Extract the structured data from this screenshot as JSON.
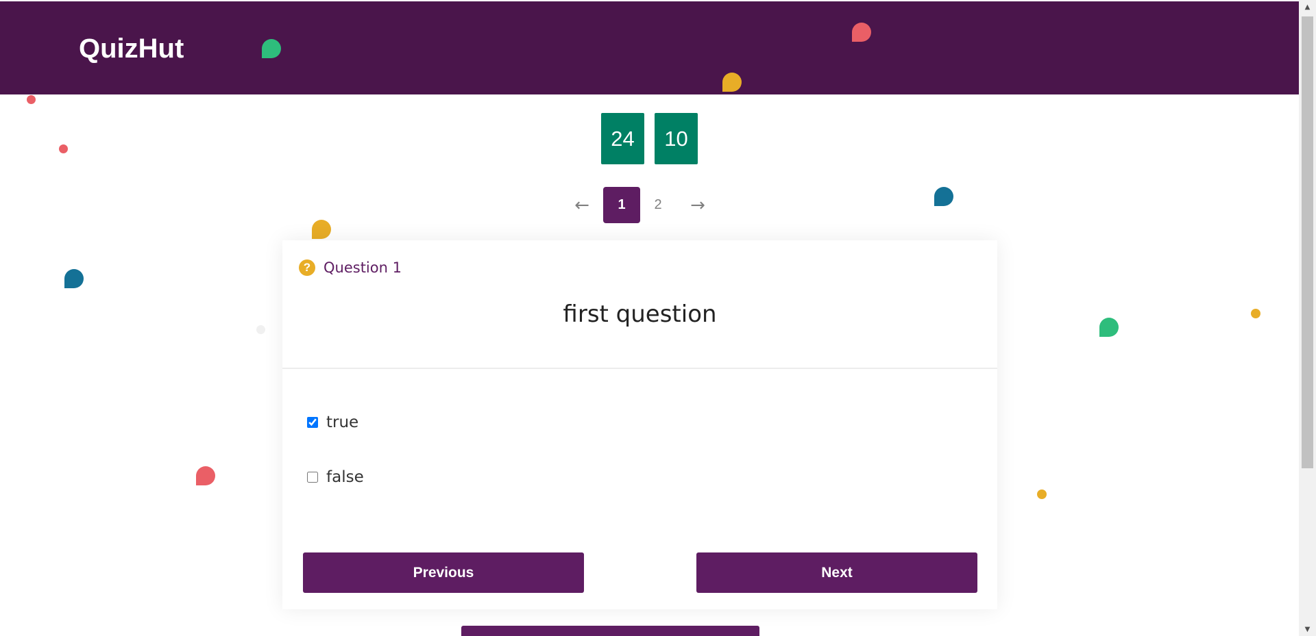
{
  "app": {
    "brand": "QuizHut"
  },
  "timer": {
    "minutes": "24",
    "seconds": "10"
  },
  "pagination": {
    "prev_icon": "arrow-left-icon",
    "next_icon": "arrow-right-icon",
    "pages": [
      "1",
      "2"
    ],
    "active_page": "1"
  },
  "question": {
    "icon": "question-circle-icon",
    "label": "Question 1",
    "text": "first question",
    "answers": [
      {
        "text": "true",
        "checked": true
      },
      {
        "text": "false",
        "checked": false
      }
    ]
  },
  "buttons": {
    "previous": "Previous",
    "next": "Next"
  },
  "colors": {
    "brand_purple": "#4a154b",
    "button_purple": "#5e1d62",
    "timer_green": "#008064",
    "accent_yellow": "#e8ad27",
    "confetti_red": "#ea5f66",
    "confetti_green": "#2ebd7c",
    "confetti_blue": "#147196"
  }
}
